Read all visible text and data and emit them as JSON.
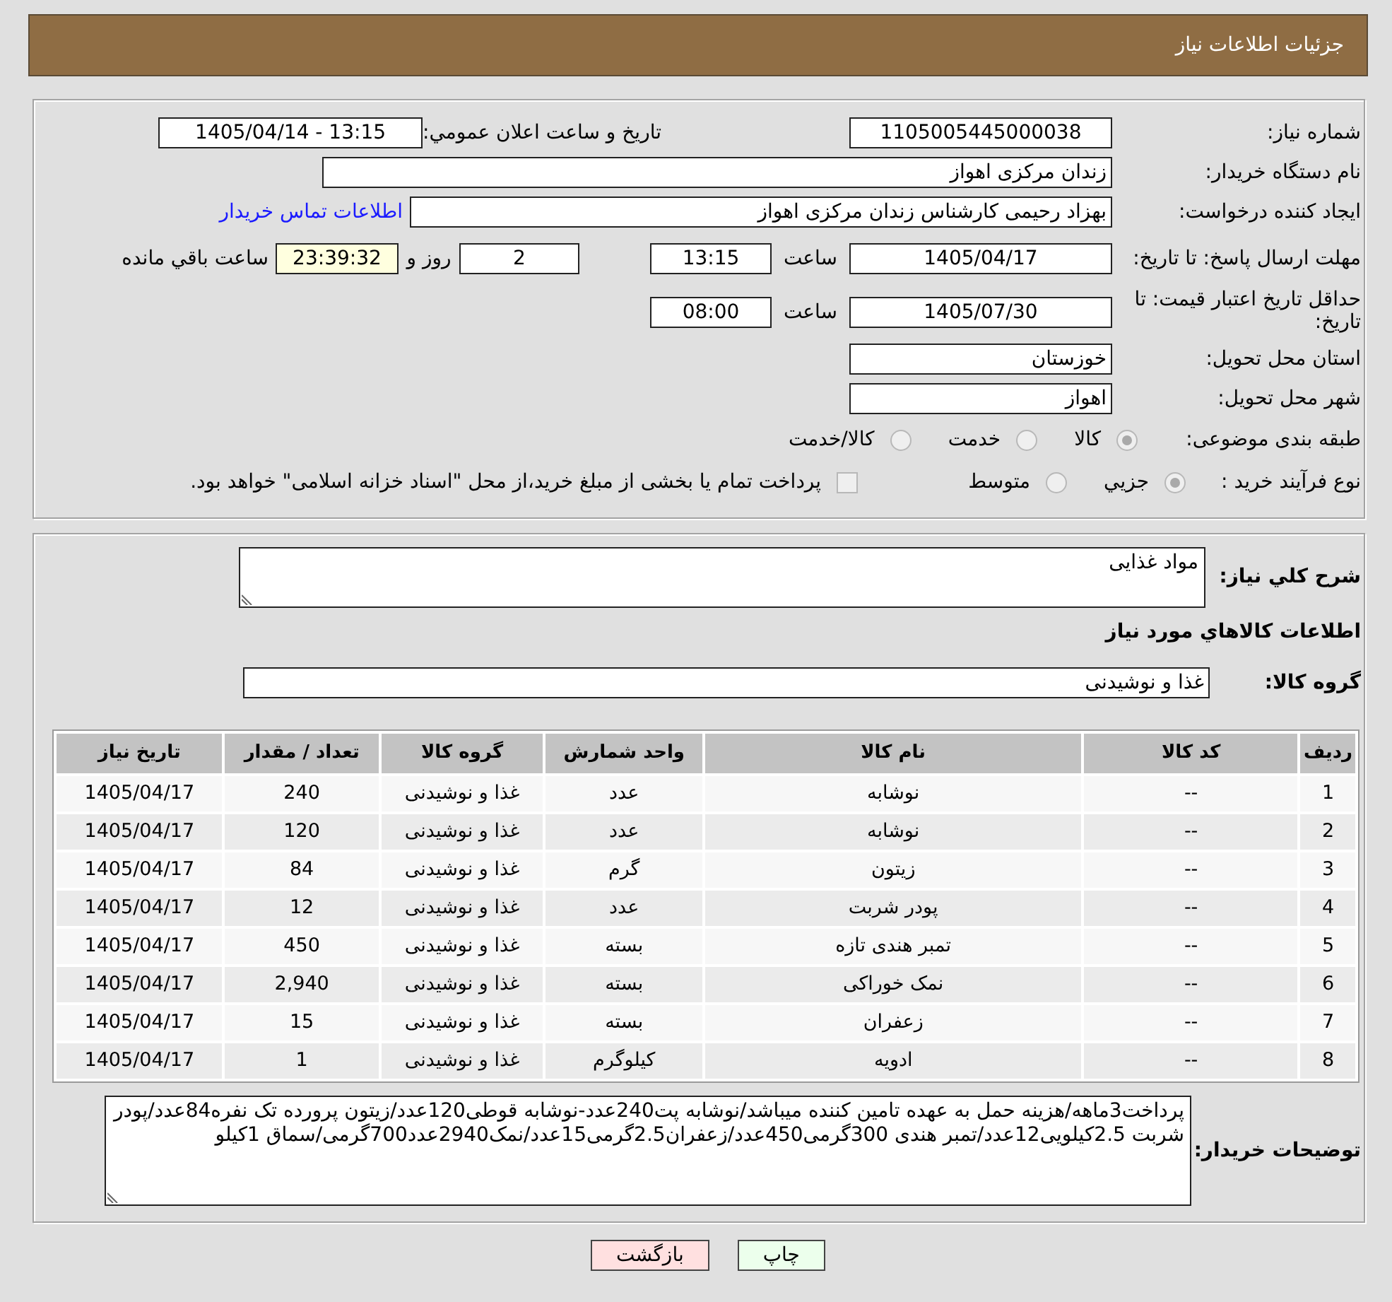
{
  "header": {
    "title": "جزئیات اطلاعات نیاز"
  },
  "general": {
    "need_number": {
      "label": "شماره نیاز:",
      "value": "1105005445000038"
    },
    "announce_date": {
      "label": "تاریخ و ساعت اعلان عمومي:",
      "value": "1405/04/14 - 13:15"
    },
    "buyer": {
      "label": "نام دستگاه خریدار:",
      "value": "زندان مرکزی اهواز"
    },
    "requester": {
      "label": "ایجاد کننده درخواست:",
      "value": "بهزاد رحیمی کارشناس زندان مرکزی اهواز",
      "link": "اطلاعات تماس خریدار"
    },
    "response_deadline": {
      "label": "مهلت ارسال پاسخ: تا تاریخ:",
      "date": "1405/04/17",
      "time_label": "ساعت",
      "time": "13:15",
      "days": "2",
      "days_label": "روز و",
      "remaining": "23:39:32",
      "remaining_label": "ساعت باقي مانده"
    },
    "price_validity": {
      "label": "حداقل تاریخ اعتبار قیمت: تا تاریخ:",
      "date": "1405/07/30",
      "time_label": "ساعت",
      "time": "08:00"
    },
    "province": {
      "label": "استان محل تحویل:",
      "value": "خوزستان"
    },
    "city": {
      "label": "شهر محل تحویل:",
      "value": "اهواز"
    },
    "category": {
      "label": "طبقه بندی موضوعی:",
      "options": [
        {
          "label": "کالا",
          "selected": true,
          "disabled": true
        },
        {
          "label": "خدمت",
          "selected": false,
          "disabled": true
        },
        {
          "label": "کالا/خدمت",
          "selected": false,
          "disabled": true
        }
      ]
    },
    "purchase_type": {
      "label": "نوع فرآیند خرید :",
      "options": [
        {
          "label": "جزيي",
          "selected": true,
          "disabled": true
        },
        {
          "label": "متوسط",
          "selected": false,
          "disabled": true
        }
      ],
      "treasury_payment": {
        "label": "پرداخت تمام یا بخشی از مبلغ خرید،از محل \"اسناد خزانه اسلامی\" خواهد بود.",
        "checked": false,
        "disabled": true
      }
    }
  },
  "goods": {
    "description": {
      "label": "شرح کلي نیاز:",
      "value": "مواد غذایی"
    },
    "section_title": "اطلاعات کالاهاي مورد نیاز",
    "group": {
      "label": "گروه کالا:",
      "value": "غذا و نوشیدنی"
    },
    "table": {
      "columns": [
        "ردیف",
        "کد کالا",
        "نام کالا",
        "واحد شمارش",
        "گروه کالا",
        "تعداد / مقدار",
        "تاریخ نیاز"
      ],
      "rows": [
        [
          "1",
          "--",
          "نوشابه",
          "عدد",
          "غذا و نوشیدنی",
          "240",
          "1405/04/17"
        ],
        [
          "2",
          "--",
          "نوشابه",
          "عدد",
          "غذا و نوشیدنی",
          "120",
          "1405/04/17"
        ],
        [
          "3",
          "--",
          "زیتون",
          "گرم",
          "غذا و نوشیدنی",
          "84",
          "1405/04/17"
        ],
        [
          "4",
          "--",
          "پودر شربت",
          "عدد",
          "غذا و نوشیدنی",
          "12",
          "1405/04/17"
        ],
        [
          "5",
          "--",
          "تمبر هندی تازه",
          "بسته",
          "غذا و نوشیدنی",
          "450",
          "1405/04/17"
        ],
        [
          "6",
          "--",
          "نمک خوراکی",
          "بسته",
          "غذا و نوشیدنی",
          "2,940",
          "1405/04/17"
        ],
        [
          "7",
          "--",
          "زعفران",
          "بسته",
          "غذا و نوشیدنی",
          "15",
          "1405/04/17"
        ],
        [
          "8",
          "--",
          "ادویه",
          "کیلوگرم",
          "غذا و نوشیدنی",
          "1",
          "1405/04/17"
        ]
      ]
    },
    "buyer_notes": {
      "label": "توضیحات خریدار:",
      "value": "پرداخت3ماهه/هزینه حمل به عهده تامین کننده میباشد/نوشابه پت240عدد-نوشابه قوطی120عدد/زیتون پرورده تک نفره84عدد/پودر شربت 2.5کیلویی12عدد/تمبر هندی 300گرمی450عدد/زعفران2.5گرمی15عدد/نمک2940عدد700گرمی/سماق 1کیلو"
    }
  },
  "buttons": [
    {
      "label": "چاپ",
      "kind": "print"
    },
    {
      "label": "بازگشت",
      "kind": "back"
    }
  ]
}
